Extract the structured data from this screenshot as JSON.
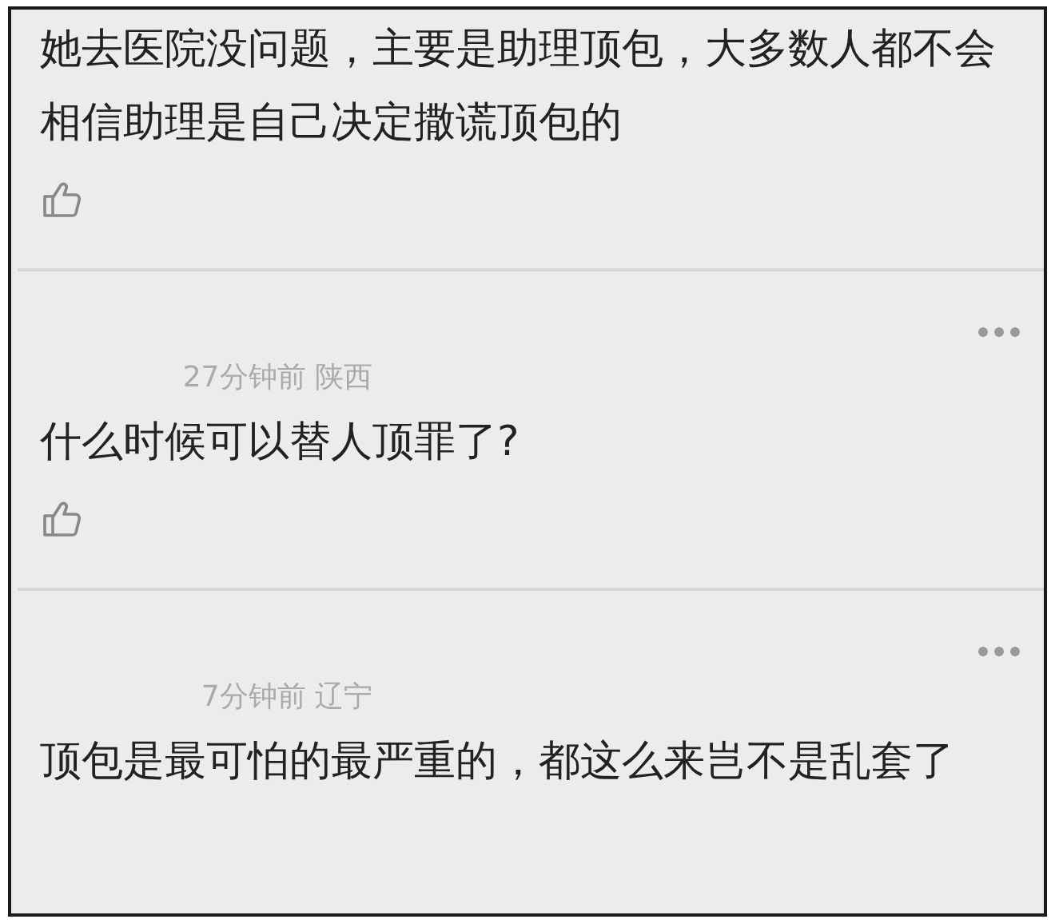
{
  "comments": [
    {
      "text": "她去医院没问题，主要是助理顶包，大多数人都不会相信助理是自己决定撒谎顶包的"
    },
    {
      "meta": "27分钟前 陕西",
      "text": "什么时候可以替人顶罪了?"
    },
    {
      "meta": "7分钟前 辽宁",
      "text": "顶包是最可怕的最严重的，都这么来岂不是乱套了"
    }
  ]
}
